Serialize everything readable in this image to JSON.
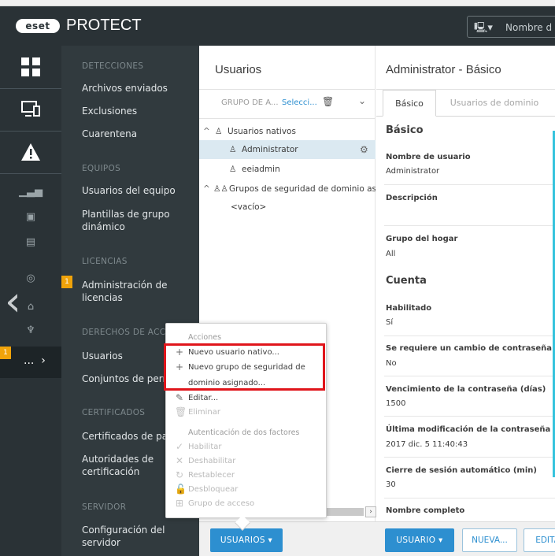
{
  "header": {
    "logo_text": "eset",
    "product": "PROTECT",
    "computer_search_placeholder": "Nombre d"
  },
  "rail": {
    "more_label": "...",
    "more_badge": "1"
  },
  "nav": {
    "sections": [
      {
        "heading": "DETECCIONES",
        "items": [
          "Archivos enviados",
          "Exclusiones",
          "Cuarentena"
        ]
      },
      {
        "heading": "EQUIPOS",
        "items": [
          "Usuarios del equipo",
          "Plantillas de grupo dinámico"
        ]
      },
      {
        "heading": "LICENCIAS",
        "items": [
          "Administración de licencias"
        ]
      },
      {
        "heading": "DERECHOS DE ACCESO",
        "items": [
          "Usuarios",
          "Conjuntos de permisos"
        ]
      },
      {
        "heading": "CERTIFICADOS",
        "items": [
          "Certificados de pares",
          "Autoridades de certificación"
        ]
      },
      {
        "heading": "SERVIDOR",
        "items": [
          "Configuración del servidor"
        ]
      }
    ],
    "license_badge": "1"
  },
  "users_panel": {
    "title": "Usuarios",
    "filter_label": "GRUPO DE A...",
    "filter_select": "Selecci...",
    "tree": [
      {
        "label": "Usuarios nativos"
      },
      {
        "label": "Administrator"
      },
      {
        "label": "eeiadmin"
      },
      {
        "label": "Grupos de seguridad de dominio asignad"
      },
      {
        "label": "<vacío>"
      }
    ]
  },
  "popup": {
    "actions_heading": "Acciones",
    "new_native_user": "Nuevo usuario nativo...",
    "new_group_line1": "Nuevo grupo de seguridad de",
    "new_group_line2": "dominio asignado...",
    "edit": "Editar...",
    "delete": "Eliminar",
    "twofa_heading": "Autenticación de dos factores",
    "enable": "Habilitar",
    "disable": "Deshabilitar",
    "reset": "Restablecer",
    "unlock": "Desbloquear",
    "access_group": "Grupo de acceso"
  },
  "detail": {
    "title": "Administrator - Básico",
    "tab_basic": "Básico",
    "tab_domain_users": "Usuarios de dominio",
    "section_basic": "Básico",
    "username_label": "Nombre de usuario",
    "username_value": "Administrator",
    "description_label": "Descripción",
    "home_group_label": "Grupo del hogar",
    "home_group_value": "All",
    "section_account": "Cuenta",
    "enabled_label": "Habilitado",
    "enabled_value": "Sí",
    "pw_change_label": "Se requiere un cambio de contraseña",
    "pw_change_value": "No",
    "pw_expiry_label": "Vencimiento de la contraseña (días)",
    "pw_expiry_value": "1500",
    "last_change_label": "Última modificación de la contraseña",
    "last_change_value": "2017 dic. 5 11:40:43",
    "auto_logout_label": "Cierre de sesión automático (min)",
    "auto_logout_value": "30",
    "full_name_label": "Nombre completo"
  },
  "bottom": {
    "users_button": "USUARIOS",
    "user_button": "USUARIO",
    "new_button": "NUEVA...",
    "edit_button": "EDITA"
  },
  "colors": {
    "dark_bg": "#2a3236",
    "nav_bg": "#313a3e",
    "accent_blue": "#2d8fd0",
    "badge_orange": "#f0a30a",
    "highlight_red": "#e0151b"
  }
}
